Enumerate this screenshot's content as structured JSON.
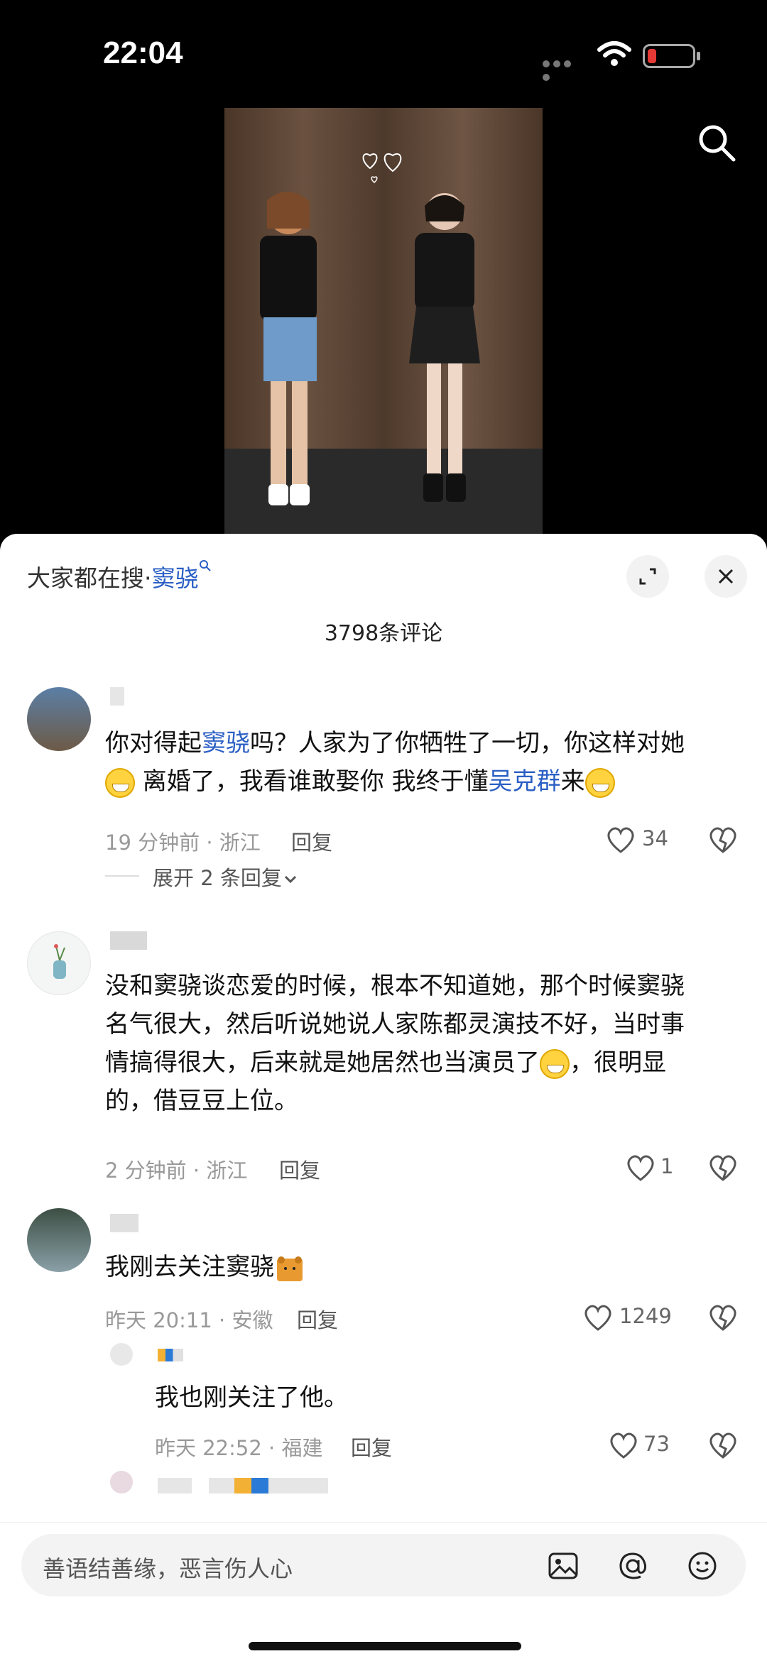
{
  "status_bar": {
    "time": "22:04"
  },
  "comments_panel": {
    "hot_search_prefix": "大家都在搜·",
    "hot_search_keyword": "窦骁",
    "comment_count": "3798条评论",
    "comments": [
      {
        "text_parts": [
          "你对得起",
          "窦骁",
          "吗？人家为了你牺牲了一切，你这样对她",
          " 离婚了，我看谁敢娶你 我终于懂",
          "吴克群",
          "来"
        ],
        "meta": "19 分钟前 · 浙江",
        "reply_label": "回复",
        "likes": "34",
        "expand_label": "展开 2 条回复"
      },
      {
        "text_line1": "没和窦骁谈恋爱的时候，根本不知道她，那个时候窦骁",
        "text_line2": "名气很大，然后听说她说人家陈都灵演技不好，当时事",
        "text_line3": "情搞得很大，后来就是她居然也当演员了",
        "text_line3b": "，很明显",
        "text_line4": "的，借豆豆上位。",
        "meta": "2 分钟前 · 浙江",
        "reply_label": "回复",
        "likes": "1"
      },
      {
        "text": "我刚去关注窦骁",
        "meta": "昨天 20:11 · 安徽",
        "reply_label": "回复",
        "likes": "1249",
        "sub_reply": {
          "text": "我也刚关注了他。",
          "meta": "昨天 22:52 · 福建",
          "reply_label": "回复",
          "likes": "73"
        }
      }
    ],
    "input_placeholder": "善语结善缘，恶言伤人心"
  },
  "colors": {
    "link": "#2b5fc4",
    "meta": "#999999",
    "battery_low": "#e53935"
  }
}
